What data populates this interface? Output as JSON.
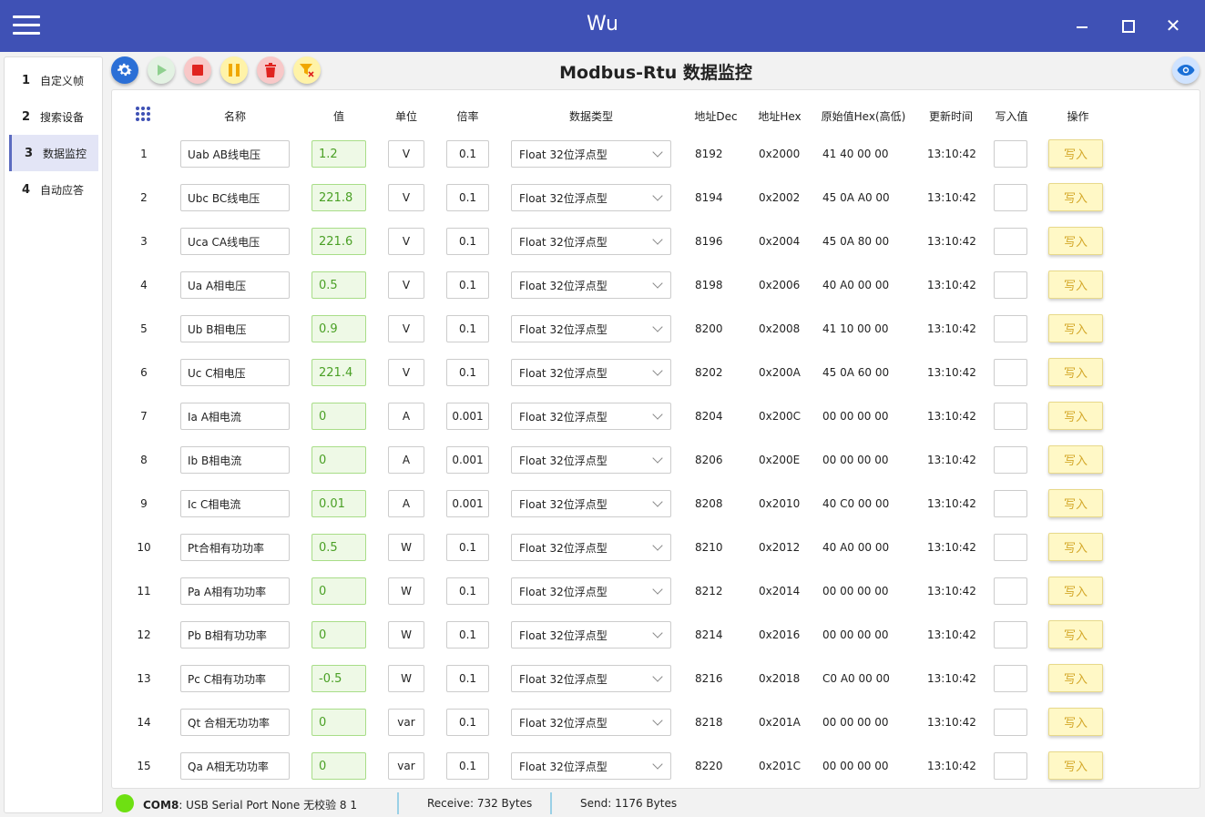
{
  "window": {
    "title": "Wu"
  },
  "sidebar": {
    "items": [
      {
        "num": "1",
        "label": "自定义帧"
      },
      {
        "num": "2",
        "label": "搜索设备"
      },
      {
        "num": "3",
        "label": "数据监控",
        "active": true
      },
      {
        "num": "4",
        "label": "自动应答"
      }
    ]
  },
  "toolbar": {
    "buttons": [
      "settings-icon",
      "play-icon",
      "stop-icon",
      "pause-icon",
      "delete-icon",
      "filter-clear-icon"
    ],
    "view_icon": "eye-icon"
  },
  "page": {
    "title": "Modbus-Rtu 数据监控"
  },
  "table": {
    "headers": {
      "name": "名称",
      "value": "值",
      "unit": "单位",
      "rate": "倍率",
      "datatype": "数据类型",
      "addr_dec": "地址Dec",
      "addr_hex": "地址Hex",
      "raw_hex": "原始值Hex(高低)",
      "update_time": "更新时间",
      "write_value": "写入值",
      "action": "操作"
    },
    "rows": [
      {
        "idx": "1",
        "name": "Uab AB线电压",
        "value": "1.2",
        "unit": "V",
        "rate": "0.1",
        "type": "Float 32位浮点型",
        "dec": "8192",
        "hex": "0x2000",
        "raw": "41 40 00 00",
        "time": "13:10:42",
        "write": "",
        "op": "写入"
      },
      {
        "idx": "2",
        "name": "Ubc BC线电压",
        "value": "221.8",
        "unit": "V",
        "rate": "0.1",
        "type": "Float 32位浮点型",
        "dec": "8194",
        "hex": "0x2002",
        "raw": "45 0A A0 00",
        "time": "13:10:42",
        "write": "",
        "op": "写入"
      },
      {
        "idx": "3",
        "name": "Uca CA线电压",
        "value": "221.6",
        "unit": "V",
        "rate": "0.1",
        "type": "Float 32位浮点型",
        "dec": "8196",
        "hex": "0x2004",
        "raw": "45 0A 80 00",
        "time": "13:10:42",
        "write": "",
        "op": "写入"
      },
      {
        "idx": "4",
        "name": "Ua A相电压",
        "value": "0.5",
        "unit": "V",
        "rate": "0.1",
        "type": "Float 32位浮点型",
        "dec": "8198",
        "hex": "0x2006",
        "raw": "40 A0 00 00",
        "time": "13:10:42",
        "write": "",
        "op": "写入"
      },
      {
        "idx": "5",
        "name": "Ub B相电压",
        "value": "0.9",
        "unit": "V",
        "rate": "0.1",
        "type": "Float 32位浮点型",
        "dec": "8200",
        "hex": "0x2008",
        "raw": "41 10 00 00",
        "time": "13:10:42",
        "write": "",
        "op": "写入"
      },
      {
        "idx": "6",
        "name": "Uc C相电压",
        "value": "221.4",
        "unit": "V",
        "rate": "0.1",
        "type": "Float 32位浮点型",
        "dec": "8202",
        "hex": "0x200A",
        "raw": "45 0A 60 00",
        "time": "13:10:42",
        "write": "",
        "op": "写入"
      },
      {
        "idx": "7",
        "name": "Ia A相电流",
        "value": "0",
        "unit": "A",
        "rate": "0.001",
        "type": "Float 32位浮点型",
        "dec": "8204",
        "hex": "0x200C",
        "raw": "00 00 00 00",
        "time": "13:10:42",
        "write": "",
        "op": "写入"
      },
      {
        "idx": "8",
        "name": "Ib B相电流",
        "value": "0",
        "unit": "A",
        "rate": "0.001",
        "type": "Float 32位浮点型",
        "dec": "8206",
        "hex": "0x200E",
        "raw": "00 00 00 00",
        "time": "13:10:42",
        "write": "",
        "op": "写入"
      },
      {
        "idx": "9",
        "name": "Ic C相电流",
        "value": "0.01",
        "unit": "A",
        "rate": "0.001",
        "type": "Float 32位浮点型",
        "dec": "8208",
        "hex": "0x2010",
        "raw": "40 C0 00 00",
        "time": "13:10:42",
        "write": "",
        "op": "写入"
      },
      {
        "idx": "10",
        "name": "Pt合相有功功率",
        "value": "0.5",
        "unit": "W",
        "rate": "0.1",
        "type": "Float 32位浮点型",
        "dec": "8210",
        "hex": "0x2012",
        "raw": "40 A0 00 00",
        "time": "13:10:42",
        "write": "",
        "op": "写入"
      },
      {
        "idx": "11",
        "name": "Pa A相有功功率",
        "value": "0",
        "unit": "W",
        "rate": "0.1",
        "type": "Float 32位浮点型",
        "dec": "8212",
        "hex": "0x2014",
        "raw": "00 00 00 00",
        "time": "13:10:42",
        "write": "",
        "op": "写入"
      },
      {
        "idx": "12",
        "name": "Pb B相有功功率",
        "value": "0",
        "unit": "W",
        "rate": "0.1",
        "type": "Float 32位浮点型",
        "dec": "8214",
        "hex": "0x2016",
        "raw": "00 00 00 00",
        "time": "13:10:42",
        "write": "",
        "op": "写入"
      },
      {
        "idx": "13",
        "name": "Pc C相有功功率",
        "value": "-0.5",
        "unit": "W",
        "rate": "0.1",
        "type": "Float 32位浮点型",
        "dec": "8216",
        "hex": "0x2018",
        "raw": "C0 A0 00 00",
        "time": "13:10:42",
        "write": "",
        "op": "写入"
      },
      {
        "idx": "14",
        "name": "Qt 合相无功功率",
        "value": "0",
        "unit": "var",
        "rate": "0.1",
        "type": "Float 32位浮点型",
        "dec": "8218",
        "hex": "0x201A",
        "raw": "00 00 00 00",
        "time": "13:10:42",
        "write": "",
        "op": "写入"
      },
      {
        "idx": "15",
        "name": "Qa A相无功功率",
        "value": "0",
        "unit": "var",
        "rate": "0.1",
        "type": "Float 32位浮点型",
        "dec": "8220",
        "hex": "0x201C",
        "raw": "00 00 00 00",
        "time": "13:10:42",
        "write": "",
        "op": "写入"
      }
    ]
  },
  "status": {
    "port": "COM8",
    "port_info": ": USB Serial Port  None   无校验  8  1",
    "receive": "Receive: 732 Bytes",
    "send": "Send: 1176 Bytes",
    "connected_color": "#6ee012"
  },
  "colors": {
    "titlebar": "#3f51b5",
    "value_text": "#4aa025",
    "write_button": "#fff8c6"
  }
}
